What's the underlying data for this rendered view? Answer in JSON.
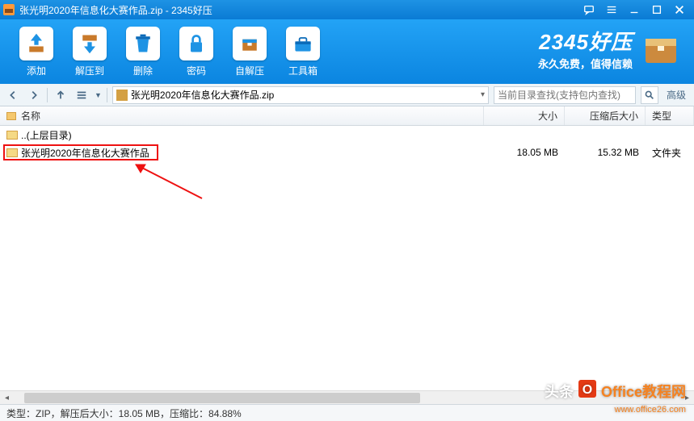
{
  "window": {
    "title": "张光明2020年信息化大赛作品.zip - 2345好压"
  },
  "toolbar": {
    "add": "添加",
    "extract": "解压到",
    "delete": "删除",
    "password": "密码",
    "sfx": "自解压",
    "tools": "工具箱"
  },
  "brand": {
    "name": "2345好压",
    "slogan": "永久免费，值得信赖"
  },
  "navbar": {
    "path": "张光明2020年信息化大赛作品.zip",
    "search_placeholder": "当前目录查找(支持包内查找)",
    "advanced": "高级"
  },
  "columns": {
    "name": "名称",
    "size": "大小",
    "compressed": "压缩后大小",
    "type": "类型"
  },
  "rows": [
    {
      "name": "..(上层目录)",
      "size": "",
      "compressed": "",
      "type": ""
    },
    {
      "name": "张光明2020年信息化大赛作品",
      "size": "18.05 MB",
      "compressed": "15.32 MB",
      "type": "文件夹"
    }
  ],
  "status": "类型：ZIP，解压后大小：18.05 MB，压缩比：84.88%",
  "watermark": {
    "prefix": "头条",
    "brand": "Office教程网",
    "url": "www.office26.com"
  }
}
